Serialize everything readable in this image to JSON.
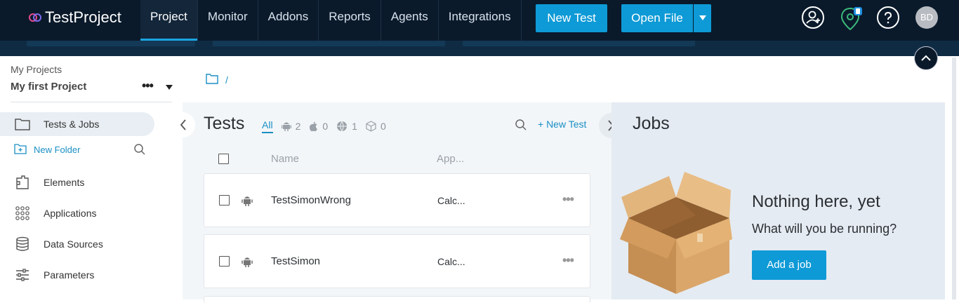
{
  "header": {
    "logo_text": "TestProject",
    "nav": [
      "Project",
      "Monitor",
      "Addons",
      "Reports",
      "Agents",
      "Integrations"
    ],
    "new_test_label": "New Test",
    "open_file_label": "Open File",
    "avatar_initials": "BD"
  },
  "sidebar": {
    "my_projects_label": "My Projects",
    "project_name": "My first Project",
    "items": [
      {
        "label": "Tests & Jobs"
      },
      {
        "label": "Elements"
      },
      {
        "label": "Applications"
      },
      {
        "label": "Data Sources"
      },
      {
        "label": "Parameters"
      }
    ],
    "new_folder_label": "New Folder"
  },
  "breadcrumb": {
    "separator": "/"
  },
  "tests": {
    "title": "Tests",
    "filter_all": "All",
    "android_count": "2",
    "ios_count": "0",
    "web_count": "1",
    "code_count": "0",
    "new_test_link": "+ New Test",
    "col_name": "Name",
    "col_app": "App...",
    "rows": [
      {
        "name": "TestSimonWrong",
        "app": "Calc..."
      },
      {
        "name": "TestSimon",
        "app": "Calc..."
      }
    ]
  },
  "jobs": {
    "title": "Jobs",
    "empty_title": "Nothing here, yet",
    "empty_sub": "What will you be running?",
    "add_job_label": "Add a job"
  },
  "colors": {
    "accent": "#0e9ad6",
    "topbar": "#0a1a2b",
    "link": "#1a8fc4"
  }
}
